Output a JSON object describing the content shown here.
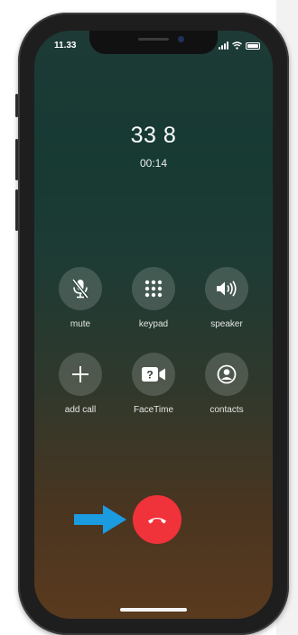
{
  "status_bar": {
    "time": "11.33"
  },
  "call": {
    "caller": "33 8",
    "duration": "00:14"
  },
  "controls": {
    "row1": [
      {
        "label": "mute",
        "icon": "mic-slash-icon"
      },
      {
        "label": "keypad",
        "icon": "keypad-icon"
      },
      {
        "label": "speaker",
        "icon": "speaker-icon"
      }
    ],
    "row2": [
      {
        "label": "add call",
        "icon": "plus-icon"
      },
      {
        "label": "FaceTime",
        "icon": "facetime-icon"
      },
      {
        "label": "contacts",
        "icon": "contacts-icon"
      }
    ]
  },
  "end_call": {
    "icon": "phone-hangup-icon",
    "color": "#f0323a"
  },
  "annotation": {
    "icon": "arrow-right-icon",
    "color": "#1b9ce0"
  }
}
